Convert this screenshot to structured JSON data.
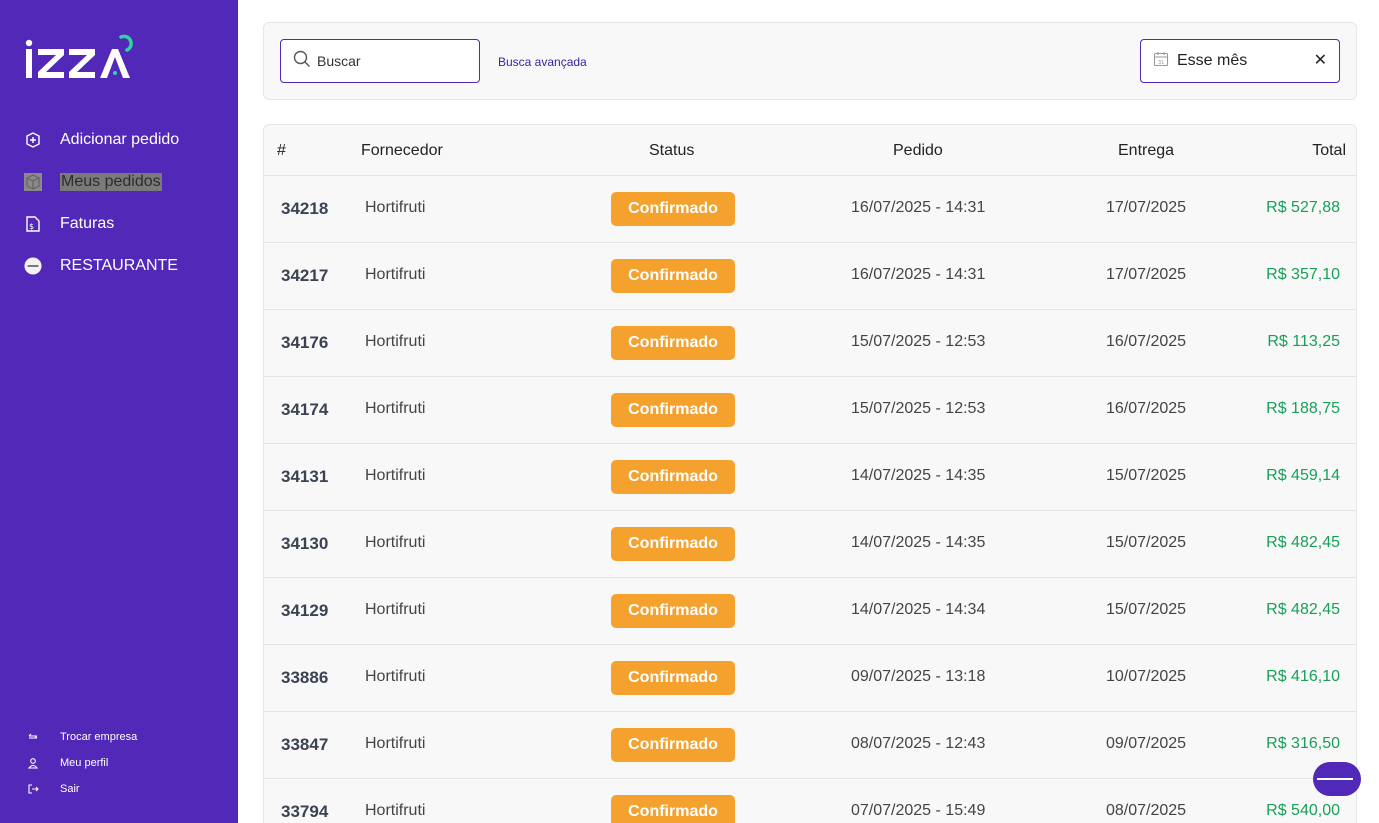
{
  "brand": {
    "logo_text": "izza"
  },
  "sidebar": {
    "items": [
      {
        "label": "Adicionar pedido",
        "icon": "add-order-icon"
      },
      {
        "label": "Meus pedidos",
        "icon": "box-icon",
        "active": true
      },
      {
        "label": "Faturas",
        "icon": "invoice-icon"
      },
      {
        "label": "RESTAURANTE",
        "icon": "restaurant-avatar-icon"
      }
    ],
    "bottom": [
      {
        "label": "Trocar empresa",
        "icon": "switch-icon"
      },
      {
        "label": "Meu perfil",
        "icon": "user-icon"
      },
      {
        "label": "Sair",
        "icon": "logout-icon"
      }
    ]
  },
  "filters": {
    "search_placeholder": "Buscar",
    "advanced_link": "Busca avançada",
    "date_value": "Esse mês",
    "clear_symbol": "✕"
  },
  "table": {
    "headers": {
      "num": "#",
      "supplier": "Fornecedor",
      "status": "Status",
      "order": "Pedido",
      "delivery": "Entrega",
      "total": "Total"
    },
    "rows": [
      {
        "num": "34218",
        "supplier": "Hortifruti",
        "status": "Confirmado",
        "order": "16/07/2025 - 14:31",
        "delivery": "17/07/2025",
        "total": "R$ 527,88"
      },
      {
        "num": "34217",
        "supplier": "Hortifruti",
        "status": "Confirmado",
        "order": "16/07/2025 - 14:31",
        "delivery": "17/07/2025",
        "total": "R$ 357,10"
      },
      {
        "num": "34176",
        "supplier": "Hortifruti",
        "status": "Confirmado",
        "order": "15/07/2025 - 12:53",
        "delivery": "16/07/2025",
        "total": "R$ 113,25"
      },
      {
        "num": "34174",
        "supplier": "Hortifruti",
        "status": "Confirmado",
        "order": "15/07/2025 - 12:53",
        "delivery": "16/07/2025",
        "total": "R$ 188,75"
      },
      {
        "num": "34131",
        "supplier": "Hortifruti",
        "status": "Confirmado",
        "order": "14/07/2025 - 14:35",
        "delivery": "15/07/2025",
        "total": "R$ 459,14"
      },
      {
        "num": "34130",
        "supplier": "Hortifruti",
        "status": "Confirmado",
        "order": "14/07/2025 - 14:35",
        "delivery": "15/07/2025",
        "total": "R$ 482,45"
      },
      {
        "num": "34129",
        "supplier": "Hortifruti",
        "status": "Confirmado",
        "order": "14/07/2025 - 14:34",
        "delivery": "15/07/2025",
        "total": "R$ 482,45"
      },
      {
        "num": "33886",
        "supplier": "Hortifruti",
        "status": "Confirmado",
        "order": "09/07/2025 - 13:18",
        "delivery": "10/07/2025",
        "total": "R$ 416,10"
      },
      {
        "num": "33847",
        "supplier": "Hortifruti",
        "status": "Confirmado",
        "order": "08/07/2025 - 12:43",
        "delivery": "09/07/2025",
        "total": "R$ 316,50"
      },
      {
        "num": "33794",
        "supplier": "Hortifruti",
        "status": "Confirmado",
        "order": "07/07/2025 - 15:49",
        "delivery": "08/07/2025",
        "total": "R$ 540,00"
      }
    ]
  },
  "colors": {
    "sidebar": "#5128b8",
    "badge": "#f4a22d",
    "total": "#18a058",
    "accent": "#2fd3a0"
  }
}
